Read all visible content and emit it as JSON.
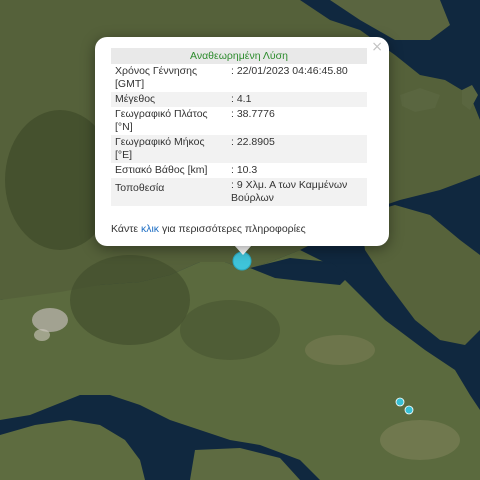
{
  "popup": {
    "title": "Αναθεωρημένη Λύση",
    "close_label": "×",
    "rows": [
      {
        "label": "Χρόνος Γέννησης [GMT]",
        "value": ": 22/01/2023 04:46:45.80"
      },
      {
        "label": "Μέγεθος",
        "value": ": 4.1"
      },
      {
        "label": "Γεωγραφικό Πλάτος [°N]",
        "value": ": 38.7776"
      },
      {
        "label": "Γεωγραφικό Μήκος [°E]",
        "value": ": 22.8905"
      },
      {
        "label": "Εστιακό Βάθος [km]",
        "value": ": 10.3"
      },
      {
        "label": "Τοποθεσία",
        "value": ": 9 Χλμ. Α των Καμμένων Βούρλων"
      }
    ],
    "footer_prefix": "Κάντε ",
    "footer_link": "κλικ",
    "footer_suffix": " για περισσότερες πληροφορίες"
  },
  "colors": {
    "title": "#2c8b2c",
    "link": "#1f6fc4",
    "marker_main": "#3fc4da",
    "marker_minor": "#38c0d4",
    "sea": "#10283f"
  }
}
